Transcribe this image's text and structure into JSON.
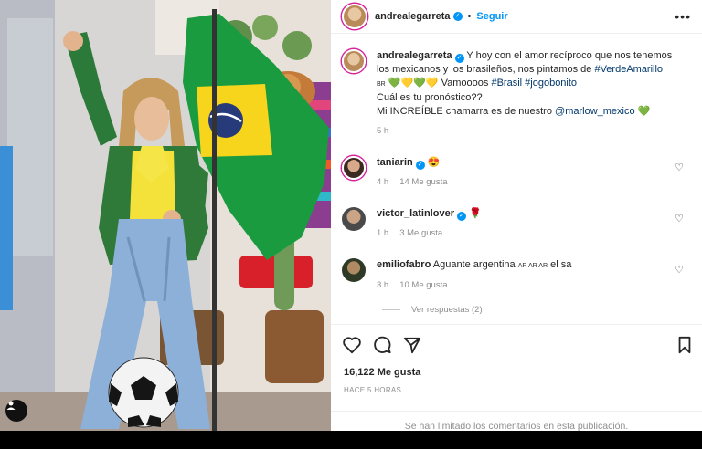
{
  "post": {
    "author": "andrealegarreta",
    "follow_label": "Seguir",
    "more_glyph": "•••",
    "caption": {
      "text_1": "Y hoy con el amor recíproco que nos tenemos los mexicanos y los brasileños, nos pintamos de ",
      "tag_1": "#VerdeAmarillo",
      "text_2": " 💚💛💚💛 Vamoooos ",
      "tag_2": "#Brasil",
      "tag_3": "#jogobonito",
      "line_3": "Cuál es tu pronóstico??",
      "line_4_a": "Mi INCREÍBLE chamarra es de nuestro ",
      "mention": "@marlow_mexico",
      "line_4_b": " 💚",
      "flag_prefix": "BR",
      "time": "5 h"
    }
  },
  "comments": [
    {
      "user": "taniarin",
      "text": "😍",
      "time": "4 h",
      "likes": "14 Me gusta"
    },
    {
      "user": "victor_latinlover",
      "text": "🌹",
      "time": "1 h",
      "likes": "3 Me gusta"
    },
    {
      "user": "emiliofabro",
      "text": "Aguante argentina ",
      "flag": "AR AR AR",
      "text_after": " el sa",
      "time": "3 h",
      "likes": "10 Me gusta"
    }
  ],
  "replies_label": "Ver respuestas (2)",
  "likes_count": "16,122 Me gusta",
  "posted_ago": "HACE 5 HORAS",
  "comments_limited": "Se han limitado los comentarios en esta publicación.",
  "colors": {
    "accent": "#0095f6",
    "link": "#00376b",
    "muted": "#8e8e8e",
    "brazil_green": "#1a9b3f",
    "brazil_yellow": "#f7d51d"
  },
  "icons": [
    "more-options-icon",
    "verified-icon",
    "heart-icon",
    "comment-icon",
    "share-icon",
    "save-icon",
    "user-tag-icon"
  ]
}
